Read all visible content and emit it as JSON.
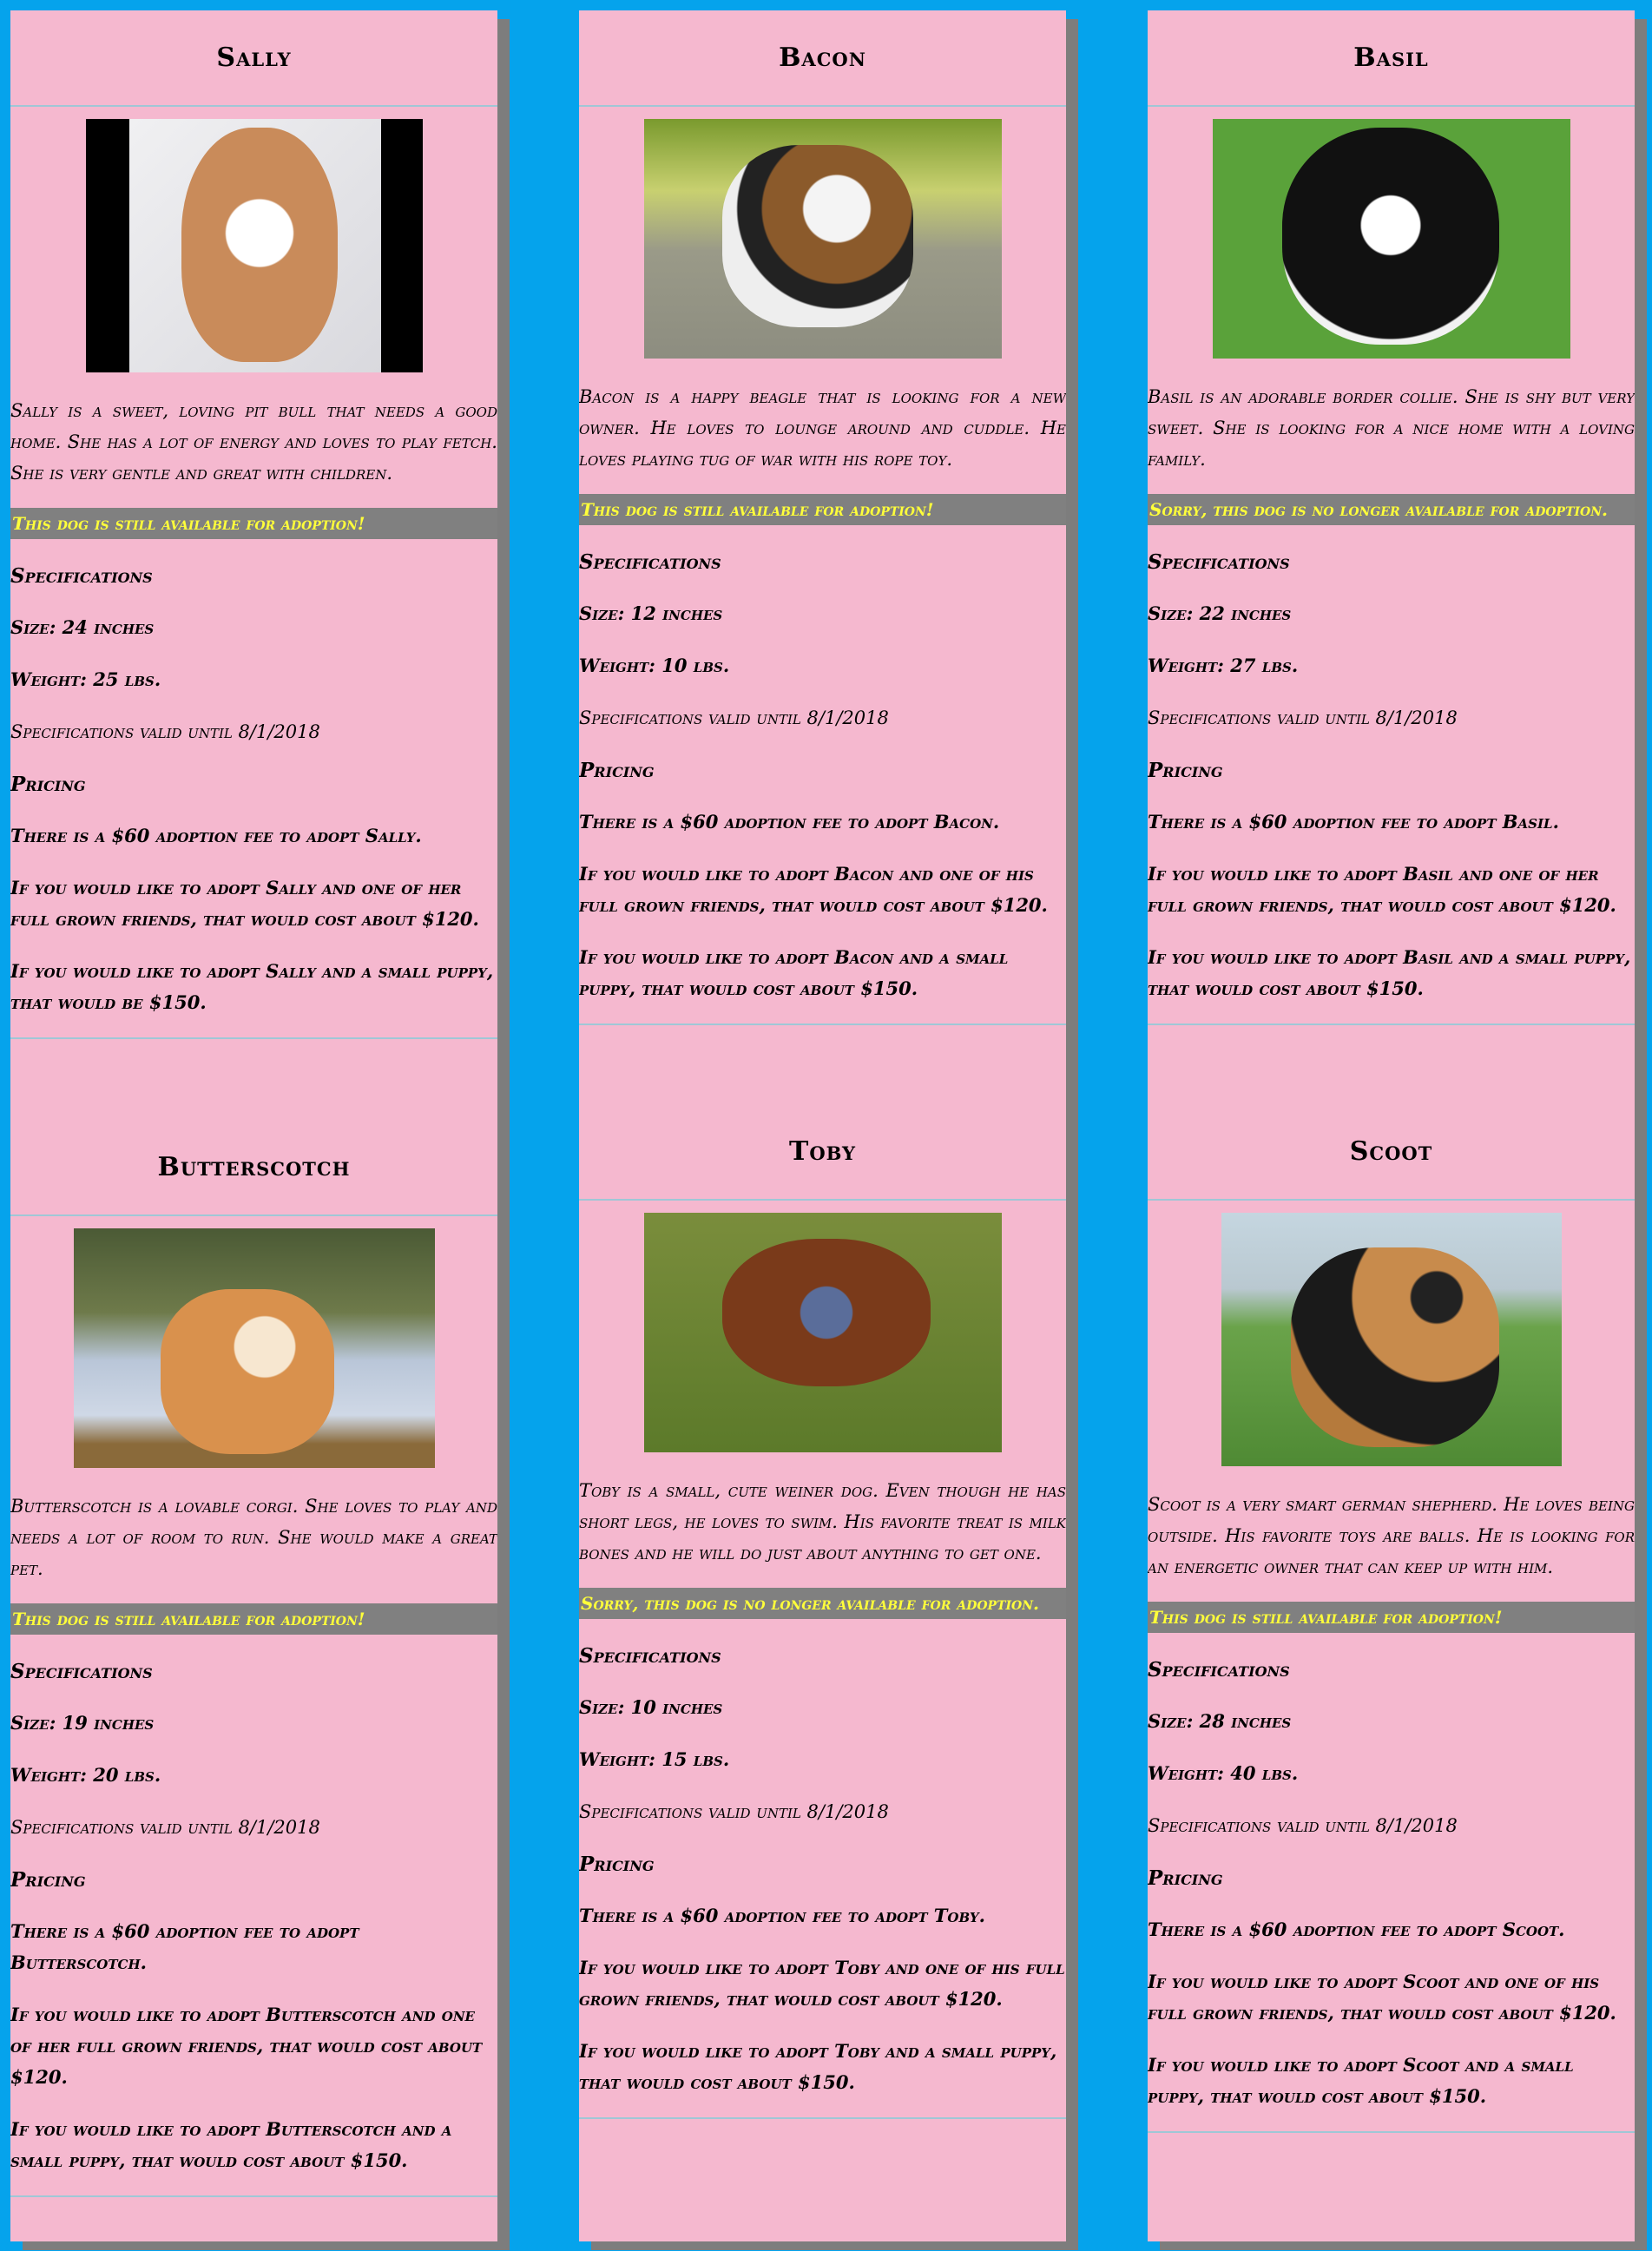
{
  "cards": [
    {
      "name": "Sally",
      "description": "Sally is a sweet, loving pit bull that needs a good home. She has a lot of energy and loves to play fetch. She is very gentle and great with children.",
      "availability": "This dog is still available for adoption!",
      "specs_heading": "Specifications",
      "size": "Size: 24 inches",
      "weight": "Weight: 25 lbs.",
      "valid": "Specifications valid until 8/1/2018",
      "pricing_heading": "Pricing",
      "fee": "There is a $60 adoption fee to adopt Sally.",
      "friend": "If you would like to adopt Sally and one of her full grown friends, that would cost about $120.",
      "puppy": "If you would like to adopt Sally and a small puppy, that would be $150."
    },
    {
      "name": "Bacon",
      "description": "Bacon is a happy beagle that is looking for a new owner. He loves to lounge around and cuddle. He loves playing tug of war with his rope toy.",
      "availability": "This dog is still available for adoption!",
      "specs_heading": "Specifications",
      "size": "Size: 12 inches",
      "weight": "Weight: 10 lbs.",
      "valid": "Specifications valid until 8/1/2018",
      "pricing_heading": "Pricing",
      "fee": "There is a $60 adoption fee to adopt Bacon.",
      "friend": "If you would like to adopt Bacon and one of his full grown friends, that would cost about $120.",
      "puppy": "If you would like to adopt Bacon and a small puppy, that would cost about $150."
    },
    {
      "name": "Basil",
      "description": "Basil is an adorable border collie. She is shy but very sweet. She is looking for a nice home with a loving family.",
      "availability": "Sorry, this dog is no longer available for adoption.",
      "specs_heading": "Specifications",
      "size": "Size: 22 inches",
      "weight": "Weight: 27 lbs.",
      "valid": "Specifications valid until 8/1/2018",
      "pricing_heading": "Pricing",
      "fee": "There is a $60 adoption fee to adopt Basil.",
      "friend": "If you would like to adopt Basil and one of her full grown friends, that would cost about $120.",
      "puppy": "If you would like to adopt Basil and a small puppy, that would cost about $150."
    },
    {
      "name": "Butterscotch",
      "description": "Butterscotch is a lovable corgi. She loves to play and needs a lot of room to run. She would make a great pet.",
      "availability": "This dog is still available for adoption!",
      "specs_heading": "Specifications",
      "size": "Size: 19 inches",
      "weight": "Weight: 20 lbs.",
      "valid": "Specifications valid until 8/1/2018",
      "pricing_heading": "Pricing",
      "fee": "There is a $60 adoption fee to adopt Butterscotch.",
      "friend": "If you would like to adopt Butterscotch and one of her full grown friends, that would cost about $120.",
      "puppy": "If you would like to adopt Butterscotch and a small puppy, that would cost about $150."
    },
    {
      "name": "Toby",
      "description": "Toby is a small, cute weiner dog. Even though he has short legs, he loves to swim. His favorite treat is milk bones and he will do just about anything to get one.",
      "availability": "Sorry, this dog is no longer available for adoption.",
      "specs_heading": "Specifications",
      "size": "Size: 10 inches",
      "weight": "Weight: 15 lbs.",
      "valid": "Specifications valid until 8/1/2018",
      "pricing_heading": "Pricing",
      "fee": "There is a $60 adoption fee to adopt Toby.",
      "friend": "If you would like to adopt Toby and one of his full grown friends, that would cost about $120.",
      "puppy": "If you would like to adopt Toby and a small puppy, that would cost about $150."
    },
    {
      "name": "Scoot",
      "description": "Scoot is a very smart german shepherd. He loves being outside. His favorite toys are balls. He is looking for an energetic owner that can keep up with him.",
      "availability": "This dog is still available for adoption!",
      "specs_heading": "Specifications",
      "size": "Size: 28 inches",
      "weight": "Weight: 40 lbs.",
      "valid": "Specifications valid until 8/1/2018",
      "pricing_heading": "Pricing",
      "fee": "There is a $60 adoption fee to adopt Scoot.",
      "friend": "If you would like to adopt Scoot and one of his full grown friends, that would cost about $120.",
      "puppy": "If you would like to adopt Scoot and a small puppy, that would cost about $150."
    }
  ]
}
